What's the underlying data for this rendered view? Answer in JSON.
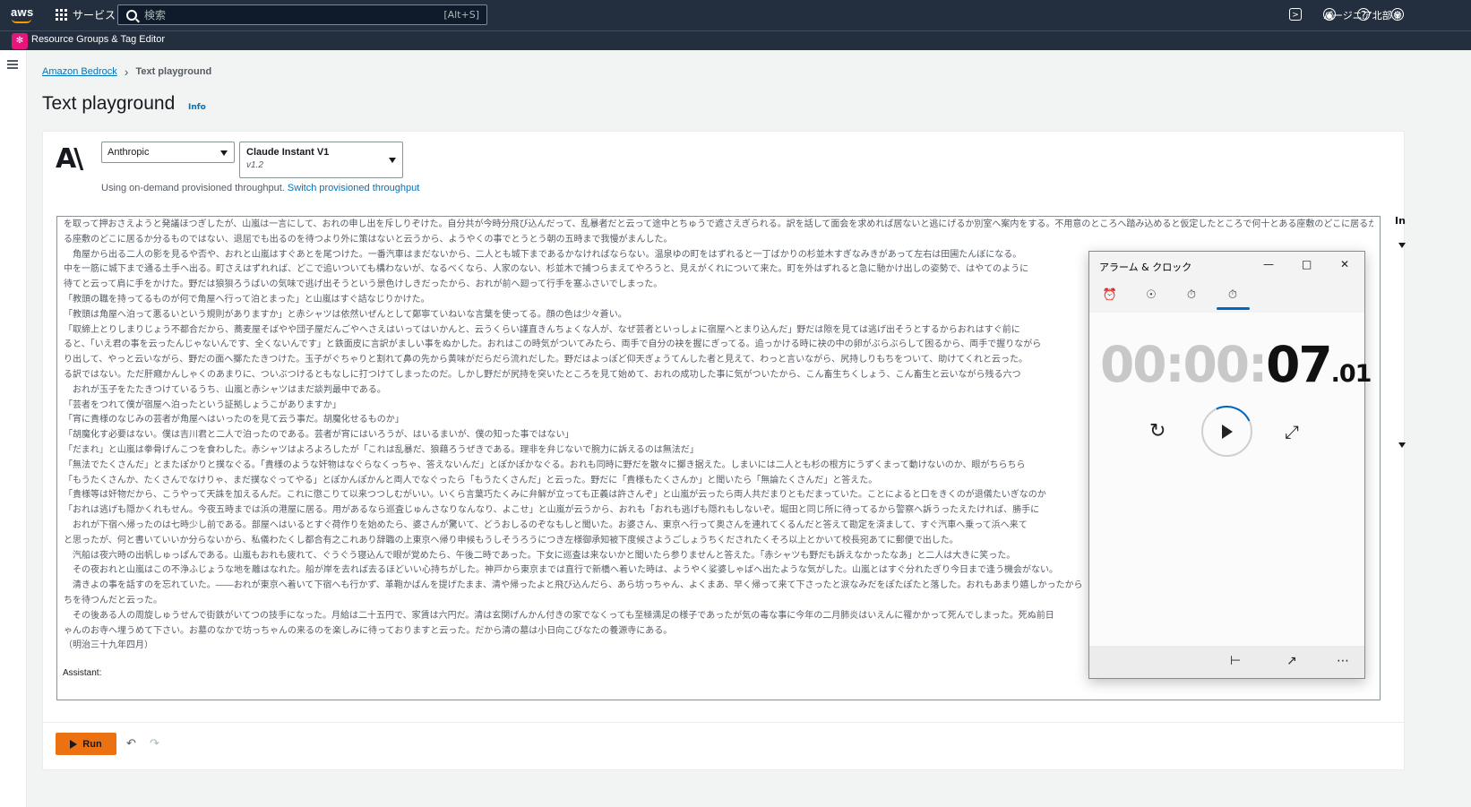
{
  "topnav": {
    "logo": "aws",
    "services_label": "サービス",
    "search_placeholder": "検索",
    "search_shortcut": "[Alt+S]",
    "region": "バージニア北部 ▾",
    "icons": [
      "cloudshell-icon",
      "bell-icon",
      "help-icon",
      "gear-icon"
    ]
  },
  "subnav": {
    "label": "Resource Groups & Tag Editor"
  },
  "breadcrumb": {
    "parent": "Amazon Bedrock",
    "current": "Text playground"
  },
  "page": {
    "title": "Text playground",
    "info": "Info"
  },
  "model_select": {
    "provider": "Anthropic",
    "model": "Claude Instant V1",
    "version": "v1.2",
    "throughput_text": "Using on-demand provisioned throughput.",
    "throughput_link": "Switch provisioned throughput"
  },
  "editor": {
    "lines": [
      "を取って押おさえようと発議ほつぎしたが、山嵐は一言にして、おれの申し出を斥しりぞけた。自分共が今時分飛び込んだって、乱暴者だと云って途中とちゅうで遮さえぎられる。訳を話して面会を求めれば居ないと逃にげるか別室へ案内をする。不用意のところへ踏み込めると仮定したところで何十とある座敷のどこに居るか分るものではない、退屈でも出るのを待つより外に策はないと云うから、ようやくの事でとうとう朝の五時まで我慢がまんした。",
      "る座敷のどこに居るか分るものではない、退屈でも出るのを待つより外に策はないと云うから、ようやくの事でとうとう朝の五時まで我慢がまんした。",
      "　角屋から出る二人の影を見るや否や、おれと山嵐はすぐあとを尾つけた。一番汽車はまだないから、二人とも城下まであるかなければならない。温泉ゆの町をはずれると一丁ばかりの杉並木すぎなみきがあって左右は田圃たんぼになる。",
      "中を一筋に城下まで通る土手へ出る。町さえはずれれば、どこで追いついても構わないが、なるべくなら、人家のない、杉並木で捕つらまえてやろうと、見えがくれについて来た。町を外はずれると急に馳かけ出しの姿勢で、はやてのように",
      "待てと云って肩に手をかけた。野だは狼狽ろうばいの気味で逃げ出そうという景色けしきだったから、おれが前へ廻って行手を塞ふさいでしまった。",
      "「教頭の職を持ってるものが何で角屋へ行って泊とまった」と山嵐はすぐ詰なじりかけた。",
      "「教頭は角屋へ泊って悪るいという規則がありますか」と赤シャツは依然いぜんとして鄭寧ていねいな言葉を使ってる。顔の色は少々蒼い。",
      "「取締上とりしまりじょう不都合だから、蕎麦屋そばやや団子屋だんごやへさえはいってはいかんと、云うくらい謹直きんちょくな人が、なぜ芸者といっしょに宿屋へとまり込んだ」野だは隙を見ては逃げ出そうとするからおれはすぐ前に",
      "ると、「いえ君の事を云ったんじゃないんです、全くないんです」と鉄面皮に言訳がましい事をぬかした。おれはこの時気がついてみたら、両手で自分の袂を握にぎってる。追っかける時に袂の中の卵がぶらぶらして困るから、両手で握りながら",
      "り出して、やっと云いながら、野だの面へ擲たたきつけた。玉子がぐちゃりと割れて鼻の先から黄味がだらだら流れだした。野だはよっぽど仰天ぎょうてんした者と見えて、わっと言いながら、尻持しりもちをついて、助けてくれと云った。",
      "る訳ではない。ただ肝癪かんしゃくのあまりに、ついぶつけるともなしに打つけてしまったのだ。しかし野だが尻持を突いたところを見て始めて、おれの成功した事に気がついたから、こん畜生ちくしょう、こん畜生と云いながら残る六つ",
      "　おれが玉子をたたきつけているうち、山嵐と赤シャツはまだ談判最中である。",
      "「芸者をつれて僕が宿屋へ泊ったという証拠しょうこがありますか」",
      "「宵に貴様のなじみの芸者が角屋へはいったのを見て云う事だ。胡魔化せるものか」",
      "「胡魔化す必要はない。僕は吉川君と二人で泊ったのである。芸者が宵にはいろうが、はいるまいが、僕の知った事ではない」",
      "「だまれ」と山嵐は拳骨げんこつを食わした。赤シャツはよろよろしたが「これは乱暴だ、狼藉ろうぜきである。理非を弁じないで腕力に訴えるのは無法だ」",
      "「無法でたくさんだ」とまたぽかりと撲なぐる。「貴様のような奸物はなぐらなくっちゃ、答えないんだ」とぽかぽかなぐる。おれも同時に野だを散々に擲き据えた。しまいには二人とも杉の根方にうずくまって動けないのか、眼がちらちら",
      "「もうたくさんか、たくさんでなけりゃ、まだ撲なぐってやる」とぽかんぽかんと両人でなぐったら「もうたくさんだ」と云った。野だに「貴様もたくさんか」と聞いたら「無論たくさんだ」と答えた。",
      "「貴様等は奸物だから、こうやって天誅を加えるんだ。これに懲こりて以来つつしむがいい。いくら言葉巧たくみに弁解が立っても正義は許さんぞ」と山嵐が云ったら両人共だまりともだまっていた。ことによると口をきくのが退儀たいぎなのか",
      "「おれは逃げも隠かくれもせん。今夜五時までは浜の港屋に居る。用があるなら巡査じゅんさなりなんなり、よこせ」と山嵐が云うから、おれも「おれも逃げも隠れもしないぞ。堀田と同じ所に待ってるから警察へ訴うったえたければ、勝手に",
      "　おれが下宿へ帰ったのは七時少し前である。部屋へはいるとすぐ荷作りを始めたら、婆さんが驚いて、どうおしるのぞなもしと聞いた。お婆さん、東京へ行って奥さんを連れてくるんだと答えて勘定を済まして、すぐ汽車へ乗って浜へ来て",
      "と思ったが、何と書いていいか分らないから、私儀わたくし都合有之これあり辞職の上東京へ帰り申候もうしそうろうにつき左様御承知被下度候さようごしょうちくだされたくそろ以上とかいて校長宛あてに郵便で出した。",
      "　汽船は夜六時の出帆しゅっぱんである。山嵐もおれも疲れて、ぐうぐう寝込んで眼が覚めたら、午後二時であった。下女に巡査は来ないかと聞いたら参りませんと答えた。「赤シャツも野だも訴えなかったなあ」と二人は大きに笑った。",
      "　その夜おれと山嵐はこの不浄ふじょうな地を離はなれた。船が岸を去れば去るほどいい心持ちがした。神戸から東京までは直行で新橋へ着いた時は、ようやく娑婆しゃばへ出たような気がした。山嵐とはすぐ分れたぎり今日まで逢う機会がない。",
      "　清きよの事を話すのを忘れていた。――おれが東京へ着いて下宿へも行かず、革鞄かばんを提げたまま、清や帰ったよと飛び込んだら、あら坊っちゃん、よくまあ、早く帰って来て下さったと涙なみだをぽたぽたと落した。おれもあまり嬉しかったから",
      "ちを待つんだと云った。",
      "　その後ある人の周旋しゅうせんで街鉄がいてつの技手になった。月給は二十五円で、家賃は六円だ。清は玄関げんかん付きの家でなくっても至極満足の様子であったが気の毒な事に今年の二月肺炎はいえんに罹かかって死んでしまった。死ぬ前日",
      "ゃんのお寺へ埋うめて下さい。お墓のなかで坊っちゃんの来るのを楽しみに待っておりますと云った。だから清の墓は小日向こびなたの養源寺にある。",
      "（明治三十九年四月）"
    ],
    "assistant_label": "Assistant:"
  },
  "actions": {
    "run": "Run"
  },
  "right_panel": {
    "initial": "In"
  },
  "clock_app": {
    "title": "アラーム & クロック",
    "tabs": [
      "alarm-icon",
      "world-clock-icon",
      "timer-icon",
      "stopwatch-icon"
    ],
    "time_dim": "00:00:",
    "time_seconds": "07",
    "time_ms": ".01"
  }
}
